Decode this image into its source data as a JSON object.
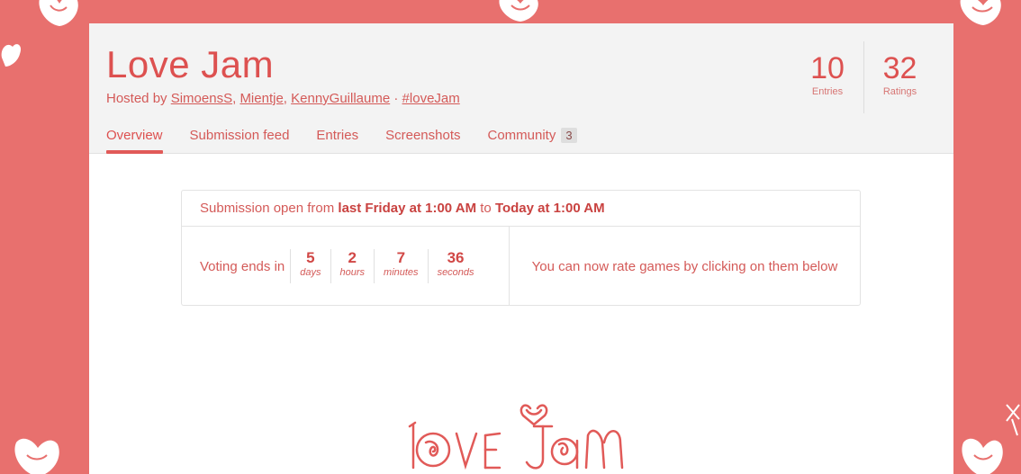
{
  "jam": {
    "title": "Love Jam",
    "hosted_prefix": "Hosted by ",
    "hosts": [
      "SimoensS",
      "Mientje",
      "KennyGuillaume"
    ],
    "separator": ", ",
    "dot": " · ",
    "hashtag": "#loveJam"
  },
  "stats": [
    {
      "value": "10",
      "label": "Entries"
    },
    {
      "value": "32",
      "label": "Ratings"
    }
  ],
  "tabs": [
    {
      "label": "Overview",
      "active": true
    },
    {
      "label": "Submission feed"
    },
    {
      "label": "Entries"
    },
    {
      "label": "Screenshots"
    },
    {
      "label": "Community",
      "badge": "3"
    }
  ],
  "submission": {
    "prefix": "Submission open from ",
    "start": "last Friday at 1:00 AM",
    "middle": " to ",
    "end": "Today at 1:00 AM"
  },
  "voting": {
    "label": "Voting ends in",
    "timer": [
      {
        "value": "5",
        "unit": "days"
      },
      {
        "value": "2",
        "unit": "hours"
      },
      {
        "value": "7",
        "unit": "minutes"
      },
      {
        "value": "36",
        "unit": "seconds"
      }
    ],
    "message": "You can now rate games by clicking on them below"
  },
  "colors": {
    "background": "#e8706e",
    "accent": "#dd5150",
    "header_bg": "#f3f3f3"
  },
  "icons": [
    "heart-doodle-icon",
    "love-jam-logo"
  ]
}
